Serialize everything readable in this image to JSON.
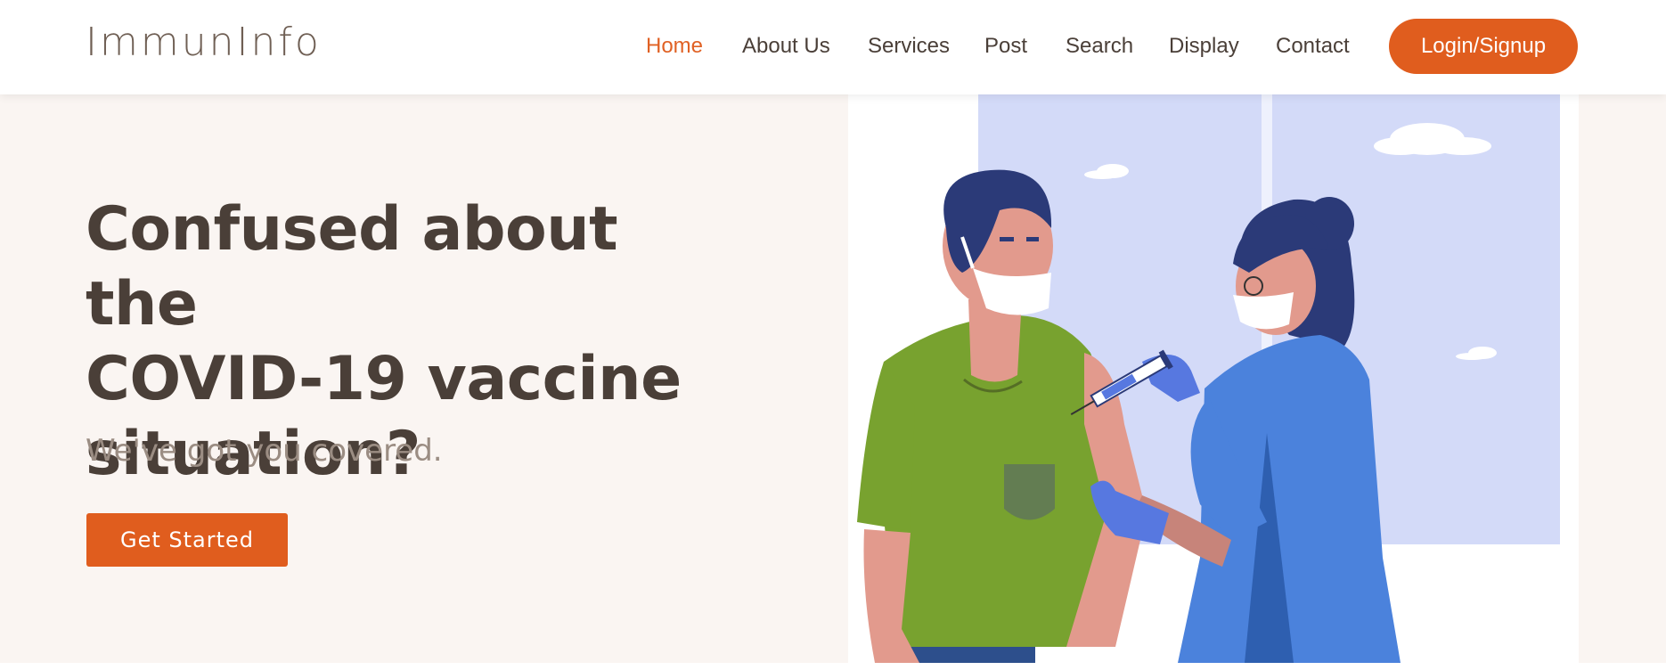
{
  "brand": {
    "name": "ImmunInfo"
  },
  "nav": {
    "items": [
      {
        "label": "Home",
        "active": true
      },
      {
        "label": "About Us"
      },
      {
        "label": "Services"
      },
      {
        "label": "Post"
      },
      {
        "label": "Search"
      },
      {
        "label": "Display"
      },
      {
        "label": "Contact"
      }
    ],
    "login_label": "Login/Signup"
  },
  "hero": {
    "headline_lines": [
      "Confused about the",
      "COVID-19 vaccine",
      "situation?"
    ],
    "subline": "We've got you covered.",
    "cta_label": "Get Started"
  },
  "colors": {
    "accent": "#e05d1e",
    "heading": "#4a3f38",
    "muted": "#9b8d83",
    "background": "#faf5f2"
  },
  "illustration": {
    "icon": "vaccination-illustration"
  }
}
